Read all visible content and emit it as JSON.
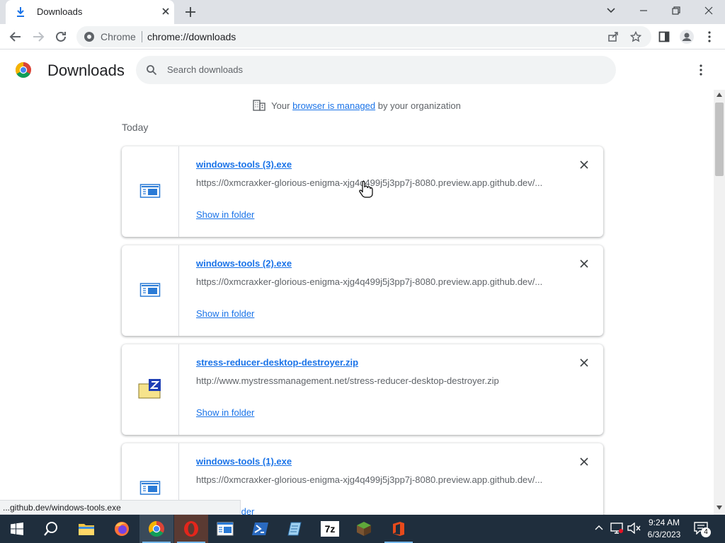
{
  "tab": {
    "title": "Downloads",
    "new_tab_symbol": "+"
  },
  "toolbar": {
    "site_label": "Chrome",
    "url": "chrome://downloads"
  },
  "downloads": {
    "title": "Downloads",
    "search_placeholder": "Search downloads",
    "managed_prefix": "Your ",
    "managed_link": "browser is managed",
    "managed_suffix": " by your organization",
    "section": "Today",
    "items": [
      {
        "name": "windows-tools (3).exe",
        "url": "https://0xmcraxker-glorious-enigma-xjg4q499j5j3pp7j-8080.preview.app.github.dev/...",
        "action": "Show in folder",
        "icon": "exe-file-icon"
      },
      {
        "name": "windows-tools (2).exe",
        "url": "https://0xmcraxker-glorious-enigma-xjg4q499j5j3pp7j-8080.preview.app.github.dev/...",
        "action": "Show in folder",
        "icon": "exe-file-icon"
      },
      {
        "name": "stress-reducer-desktop-destroyer.zip",
        "url": "http://www.mystressmanagement.net/stress-reducer-desktop-destroyer.zip",
        "action": "Show in folder",
        "icon": "zip-file-icon"
      },
      {
        "name": "windows-tools (1).exe",
        "url": "https://0xmcraxker-glorious-enigma-xjg4q499j5j3pp7j-8080.preview.app.github.dev/...",
        "action": "Show in folder",
        "icon": "exe-file-icon"
      }
    ]
  },
  "status_bubble": "...github.dev/windows-tools.exe",
  "taskbar": {
    "time": "9:24 AM",
    "date": "6/3/2023",
    "notification_count": "4",
    "seven_zip_label": "7z"
  },
  "colors": {
    "link": "#1a73e8",
    "taskbar": "#1f2e3d",
    "tab_strip": "#dee1e6"
  }
}
